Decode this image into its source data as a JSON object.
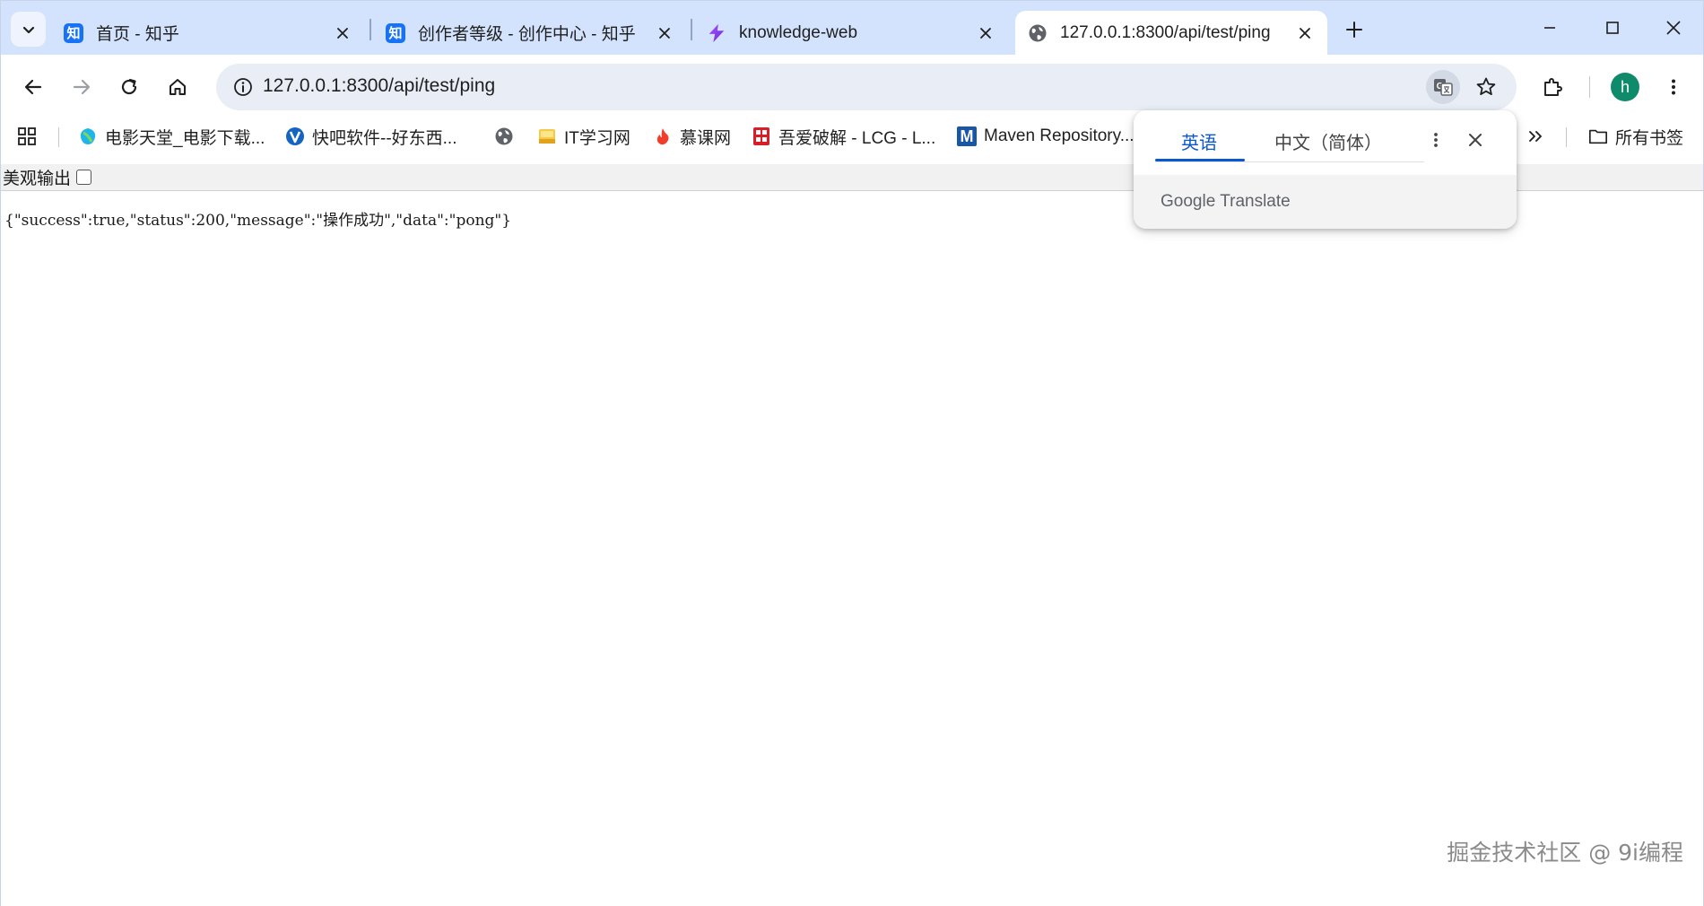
{
  "window": {
    "tabs": [
      {
        "title": "首页 - 知乎",
        "favicon": "zhihu-icon",
        "favicon_text": "知",
        "active": false
      },
      {
        "title": "创作者等级 - 创作中心 - 知乎",
        "favicon": "zhihu-icon",
        "favicon_text": "知",
        "active": false
      },
      {
        "title": "knowledge-web",
        "favicon": "lightning-icon",
        "active": false
      },
      {
        "title": "127.0.0.1:8300/api/test/ping",
        "favicon": "globe-icon",
        "active": true
      }
    ],
    "profile_initial": "h"
  },
  "toolbar": {
    "url": "127.0.0.1:8300/api/test/ping"
  },
  "bookmarks": {
    "items": [
      {
        "label": "电影天堂_电影下载...",
        "icon": "leaf-icon"
      },
      {
        "label": "快吧软件--好东西...",
        "icon": "v-shield-icon"
      },
      {
        "label": "",
        "icon": "globe-icon"
      },
      {
        "label": "IT学习网",
        "icon": "folder-note-icon"
      },
      {
        "label": "慕课网",
        "icon": "flame-icon"
      },
      {
        "label": "吾爱破解 - LCG - L...",
        "icon": "seal-icon"
      },
      {
        "label": "Maven Repository...",
        "icon": "maven-m-icon",
        "icon_text": "M"
      }
    ],
    "all_bookmarks_label": "所有书签"
  },
  "content": {
    "prettyprint_label": "美观输出",
    "prettyprint_checked": false,
    "json_text": "{\"success\":true,\"status\":200,\"message\":\"操作成功\",\"data\":\"pong\"}",
    "watermark": "掘金技术社区 @ 9i编程"
  },
  "translate_popup": {
    "source_lang": "英语",
    "target_lang": "中文（简体）",
    "brand_google": "Google",
    "brand_translate": "Translate"
  },
  "colors": {
    "tabstrip_bg": "#d3e3fd",
    "accent_blue": "#0b57d0",
    "zhihu_blue": "#1772f6",
    "avatar_green": "#0f8a6b"
  }
}
